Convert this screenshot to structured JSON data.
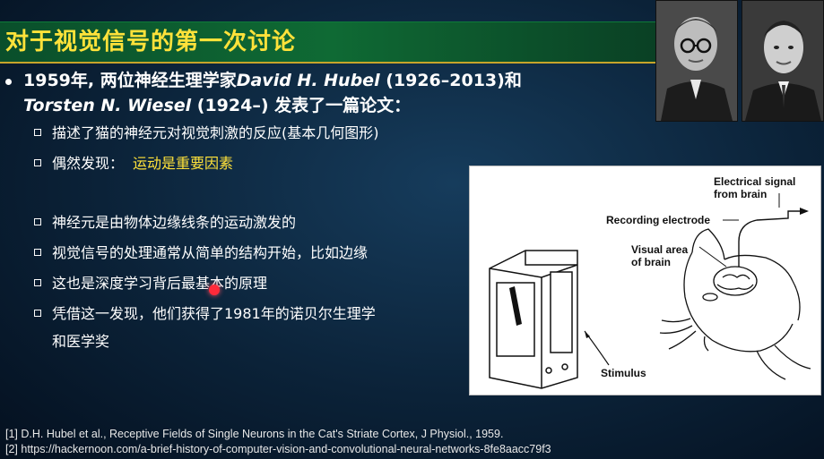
{
  "title": "对于视觉信号的第一次讨论",
  "main_bullet": {
    "part1": "1959年, 两位神经生理学家",
    "name1": "David H. Hubel",
    "part2": " (1926–2013)和",
    "name2": "Torsten N. Wiesel",
    "part3": " (1924–) 发表了一篇论文："
  },
  "sub_bullets": {
    "b1": "描述了猫的神经元对视觉刺激的反应(基本几何图形)",
    "b2_prefix": "偶然发现：",
    "b2_highlight": "运动是重要因素",
    "b3": "神经元是由物体边缘线条的运动激发的",
    "b4": "视觉信号的处理通常从简单的结构开始，比如边缘",
    "b5": "这也是深度学习背后最基本的原理",
    "b6_line1": "凭借这一发现，他们获得了1981年的诺贝尔生理学",
    "b6_line2": "和医学奖"
  },
  "figure": {
    "electrical_signal_line1": "Electrical signal",
    "electrical_signal_line2": "from brain",
    "recording_electrode": "Recording electrode",
    "visual_area_line1": "Visual area",
    "visual_area_line2": "of brain",
    "stimulus": "Stimulus"
  },
  "references": {
    "r1": "[1] D.H. Hubel et al., Receptive Fields of Single Neurons in the Cat's Striate Cortex, J Physiol., 1959.",
    "r2": "[2] https://hackernoon.com/a-brief-history-of-computer-vision-and-convolutional-neural-networks-8fe8aacc79f3"
  },
  "colors": {
    "title": "#ffe23a",
    "highlight": "#ffe23a",
    "title_band": "#0f6a34",
    "background": "#0b2238"
  }
}
